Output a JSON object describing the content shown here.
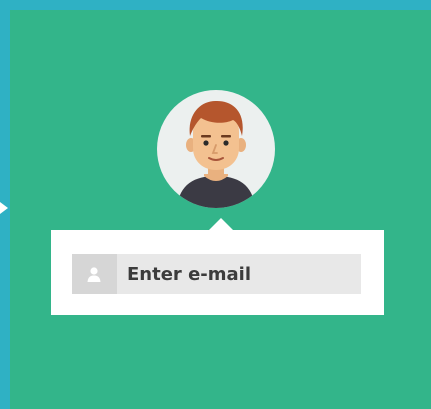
{
  "login": {
    "email_placeholder": "Enter e-mail",
    "email_value": ""
  },
  "icons": {
    "field_icon": "user-icon",
    "avatar": "male-avatar-illustration"
  },
  "colors": {
    "outer_background": "#2fb1c4",
    "panel_background": "#33b58a",
    "card_background": "#ffffff",
    "field_background": "#e8e8e8",
    "icon_box_background": "#d6d6d6",
    "text_color": "#3c3c3c"
  }
}
